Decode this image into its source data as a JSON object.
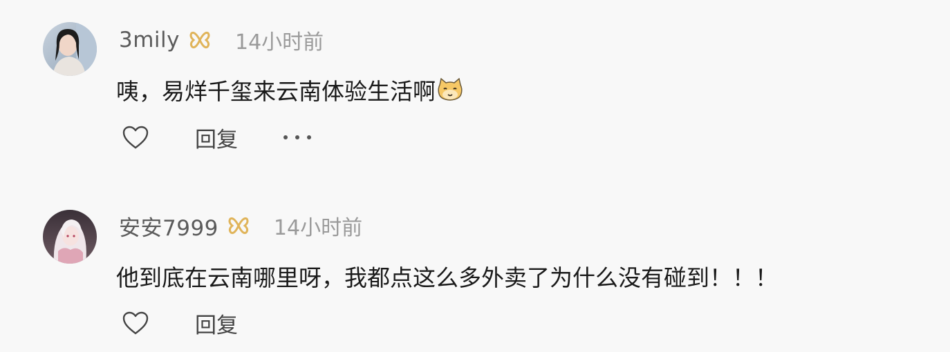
{
  "comments": [
    {
      "username": "3mily",
      "time": "14小时前",
      "text": "咦，易烊千玺来云南体验生活啊",
      "emoji": "cat-face-icon",
      "reply_label": "回复",
      "has_more": true
    },
    {
      "username": "安安7999",
      "time": "14小时前",
      "text": "他到底在云南哪里呀，我都点这么多外卖了为什么没有碰到！！！",
      "reply_label": "回复",
      "has_more": false
    }
  ],
  "colors": {
    "background": "#f8f8f8",
    "badge": "#e0b45a",
    "username": "#5b5b5b",
    "time": "#9a9a9a",
    "text": "#1a1a1a"
  }
}
